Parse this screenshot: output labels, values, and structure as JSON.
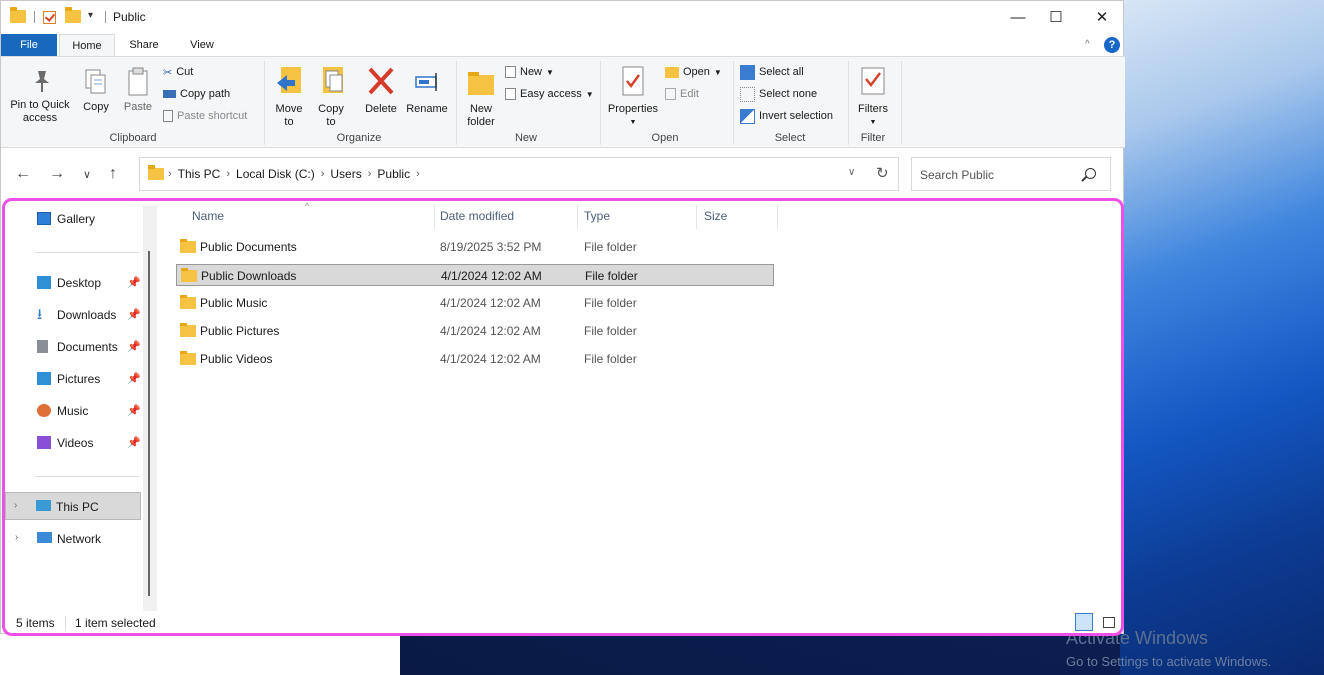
{
  "window": {
    "title": "Public",
    "controls": {
      "minimize": "—",
      "maximize": "☐",
      "close": "✕"
    }
  },
  "ribbon_tabs": [
    "File",
    "Home",
    "Share",
    "View"
  ],
  "ribbon": {
    "clipboard": {
      "label": "Clipboard",
      "pin": "Pin to Quick access",
      "copy": "Copy",
      "paste": "Paste",
      "cut": "Cut",
      "copy_path": "Copy path",
      "paste_shortcut": "Paste shortcut"
    },
    "organize": {
      "label": "Organize",
      "move_to": "Move to",
      "copy_to": "Copy to",
      "delete": "Delete",
      "rename": "Rename"
    },
    "new": {
      "label": "New",
      "new_folder": "New folder",
      "new_item": "New",
      "easy_access": "Easy access"
    },
    "open": {
      "label": "Open",
      "properties": "Properties",
      "open": "Open",
      "edit": "Edit"
    },
    "select": {
      "label": "Select",
      "select_all": "Select all",
      "select_none": "Select none",
      "invert_selection": "Invert selection"
    },
    "filter": {
      "label": "Filter",
      "filters": "Filters"
    }
  },
  "address": {
    "crumbs": [
      "This PC",
      "Local Disk (C:)",
      "Users",
      "Public"
    ],
    "search_placeholder": "Search Public"
  },
  "nav_pane": {
    "gallery": "Gallery",
    "quick_access": [
      {
        "label": "Desktop",
        "icon": "desktop-icon"
      },
      {
        "label": "Downloads",
        "icon": "downloads-icon"
      },
      {
        "label": "Documents",
        "icon": "documents-icon"
      },
      {
        "label": "Pictures",
        "icon": "pictures-icon"
      },
      {
        "label": "Music",
        "icon": "music-icon"
      },
      {
        "label": "Videos",
        "icon": "videos-icon"
      }
    ],
    "this_pc": "This PC",
    "network": "Network"
  },
  "columns": {
    "name": "Name",
    "date": "Date modified",
    "type": "Type",
    "size": "Size"
  },
  "files": [
    {
      "name": "Public Documents",
      "date": "8/19/2025 3:52 PM",
      "type": "File folder"
    },
    {
      "name": "Public Downloads",
      "date": "4/1/2024 12:02 AM",
      "type": "File folder"
    },
    {
      "name": "Public Music",
      "date": "4/1/2024 12:02 AM",
      "type": "File folder"
    },
    {
      "name": "Public Pictures",
      "date": "4/1/2024 12:02 AM",
      "type": "File folder"
    },
    {
      "name": "Public Videos",
      "date": "4/1/2024 12:02 AM",
      "type": "File folder"
    }
  ],
  "status": {
    "count": "5 items",
    "selected": "1 item selected"
  },
  "watermark": {
    "title": "Activate Windows",
    "subtitle": "Go to Settings to activate Windows."
  },
  "colors": {
    "accent": "#1868bd",
    "highlight_frame": "#ee4fe6",
    "folder": "#f5c242"
  }
}
